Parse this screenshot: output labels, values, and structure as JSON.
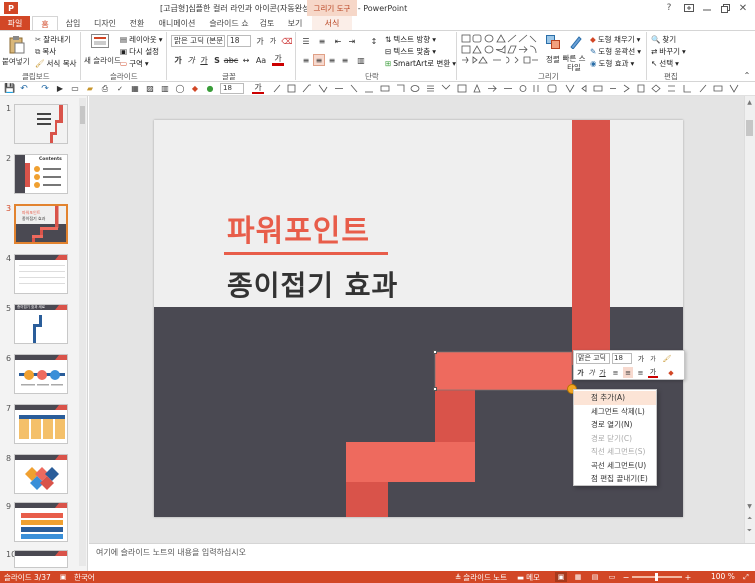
{
  "window": {
    "title": "[고급형]심플한 컬러 라인과 아이콘(자동완성형포함).pptx - PowerPoint",
    "contextual_tab_group": "그리기 도구"
  },
  "tabs": [
    "파일",
    "홈",
    "삽입",
    "디자인",
    "전환",
    "애니메이션",
    "슬라이드 쇼",
    "검토",
    "보기",
    "서식"
  ],
  "ribbon": {
    "clipboard": {
      "paste": "붙여넣기",
      "cut": "잘라내기",
      "copy": "복사",
      "format_painter": "서식 복사",
      "label": "클립보드"
    },
    "slides": {
      "new_slide": "새 슬라이드",
      "layout": "레이아웃",
      "reset": "다시 설정",
      "section": "구역",
      "label": "슬라이드"
    },
    "font": {
      "name": "맑은 고딕 (본문",
      "size": "18",
      "label": "글꼴"
    },
    "paragraph": {
      "text_direction": "텍스트 방향",
      "align_text": "텍스트 맞춤",
      "smartart": "SmartArt로 변환",
      "label": "단락"
    },
    "drawing": {
      "arrange": "정렬",
      "quick_styles": "빠른 스타일",
      "shape_fill": "도형 채우기",
      "shape_outline": "도형 윤곽선",
      "shape_effects": "도형 효과",
      "label": "그리기"
    },
    "editing": {
      "find": "찾기",
      "replace": "바꾸기",
      "select": "선택",
      "label": "편집"
    }
  },
  "qat": {
    "font_size": "18"
  },
  "thumbnails": [
    {
      "num": "1"
    },
    {
      "num": "2",
      "title": "Contents"
    },
    {
      "num": "3",
      "line1": "파워포인트",
      "line2": "종이접기 효과"
    },
    {
      "num": "4"
    },
    {
      "num": "5",
      "title": "종이접기 효과 세로"
    },
    {
      "num": "6"
    },
    {
      "num": "7"
    },
    {
      "num": "8"
    },
    {
      "num": "9"
    },
    {
      "num": "10"
    }
  ],
  "slide": {
    "title": "파워포인트",
    "subtitle": "종이접기 효과"
  },
  "mini_toolbar": {
    "font": "맑은 고딕",
    "size": "18"
  },
  "context_menu": [
    {
      "label": "점 추가(A)",
      "enabled": true,
      "highlight": true
    },
    {
      "label": "세그먼트 삭제(L)",
      "enabled": true
    },
    {
      "label": "경로 열기(N)",
      "enabled": true
    },
    {
      "label": "경로 닫기(C)",
      "enabled": false
    },
    {
      "label": "직선 세그먼트(S)",
      "enabled": false
    },
    {
      "label": "곡선 세그먼트(U)",
      "enabled": true
    },
    {
      "label": "점 편집 끝내기(E)",
      "enabled": true
    }
  ],
  "notes": {
    "placeholder": "여기에 슬라이드 노트의 내용을 입력하십시오"
  },
  "status": {
    "slide": "슬라이드 3/37",
    "language": "한국어",
    "notes": "슬라이드 노트",
    "comments": "메모",
    "zoom": "100 %"
  },
  "colors": {
    "accent": "#d24726",
    "shape_red": "#d9534a",
    "shape_light": "#ee6a5e",
    "slide_dark": "#4a4952",
    "slide_light": "#efefef"
  }
}
